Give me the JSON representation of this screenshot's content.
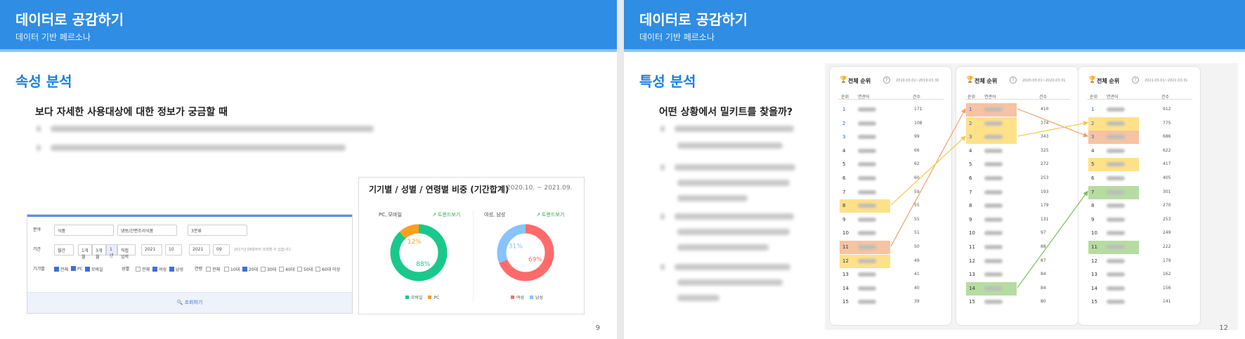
{
  "left": {
    "header_title": "데이터로 공감하기",
    "header_subtitle": "데이터 기반 페르소나",
    "section_title": "속성 분석",
    "question": "보다 자세한 사용대상에 대한 정보가 궁금할 때",
    "page_number": "9",
    "filter": {
      "row1_label": "분야",
      "row1_select1": "식품",
      "row1_select2": "냉동/간편조리식품",
      "row1_select3": "3분류",
      "row2_label": "기간",
      "row2_select1": "월간",
      "row2_periods": [
        "1개월",
        "3개월",
        "1년",
        "직접입력"
      ],
      "row2_year1": "2021",
      "row2_month1": "10",
      "row2_year2": "2021",
      "row2_month2": "09",
      "row2_note": "2017년 08월부터 조회할 수 있습니다.",
      "device_label": "기기별",
      "device_options": [
        "전체",
        "PC",
        "모바일"
      ],
      "gender_label": "성별",
      "gender_options": [
        "전체",
        "여성",
        "남성"
      ],
      "age_label": "연령",
      "age_options": [
        "전체",
        "10대",
        "20대",
        "30대",
        "40대",
        "50대",
        "60대 이상"
      ],
      "search_label": "조회하기"
    },
    "chart": {
      "title": "기기별 / 성별 / 연령별 비중 (기간합계)",
      "period": "2020.10. ~ 2021.09.",
      "trend_link": "트렌드보기",
      "donut1_label": "PC, 모바일",
      "donut2_label": "여성, 남성"
    }
  },
  "right": {
    "header_title": "데이터로 공감하기",
    "header_subtitle": "데이터 기반 페르소나",
    "section_title": "특성 분석",
    "question": "어떤 상황에서 밀키트를 찾을까?",
    "page_number": "12",
    "rank_panels": [
      {
        "title": "전체 순위",
        "date": "2019.03.01~2019.03.30",
        "head_rank": "순위",
        "head_kw": "연관어",
        "head_count": "건수",
        "counts": [
          "171",
          "108",
          "99",
          "66",
          "62",
          "60",
          "59",
          "55",
          "55",
          "51",
          "50",
          "49",
          "41",
          "40",
          "39"
        ]
      },
      {
        "title": "전체 순위",
        "date": "2020.03.01~2020.03.31",
        "head_rank": "순위",
        "head_kw": "연관어",
        "head_count": "건수",
        "counts": [
          "410",
          "374",
          "343",
          "325",
          "272",
          "253",
          "193",
          "179",
          "131",
          "97",
          "88",
          "87",
          "84",
          "84",
          "80"
        ]
      },
      {
        "title": "전체 순위",
        "date": "2021.03.01~2021.03.31",
        "head_rank": "순위",
        "head_kw": "연관어",
        "head_count": "건수",
        "counts": [
          "912",
          "775",
          "686",
          "622",
          "417",
          "405",
          "301",
          "270",
          "253",
          "249",
          "222",
          "179",
          "162",
          "156",
          "141"
        ]
      }
    ]
  },
  "chart_data": [
    {
      "type": "pie",
      "title": "PC, 모바일",
      "categories": [
        "모바일",
        "PC"
      ],
      "values": [
        88,
        12
      ],
      "colors": [
        "#18c98b",
        "#ff9f1c"
      ]
    },
    {
      "type": "pie",
      "title": "여성, 남성",
      "categories": [
        "여성",
        "남성"
      ],
      "values": [
        69,
        31
      ],
      "colors": [
        "#ff6b6b",
        "#86c3ff"
      ]
    }
  ],
  "colors": {
    "header": "#2f8de4",
    "accent": "#1f7fd6",
    "highlight_orange": "#f6c3a3",
    "highlight_yellow": "#ffe18a",
    "highlight_green": "#b6dca2"
  }
}
